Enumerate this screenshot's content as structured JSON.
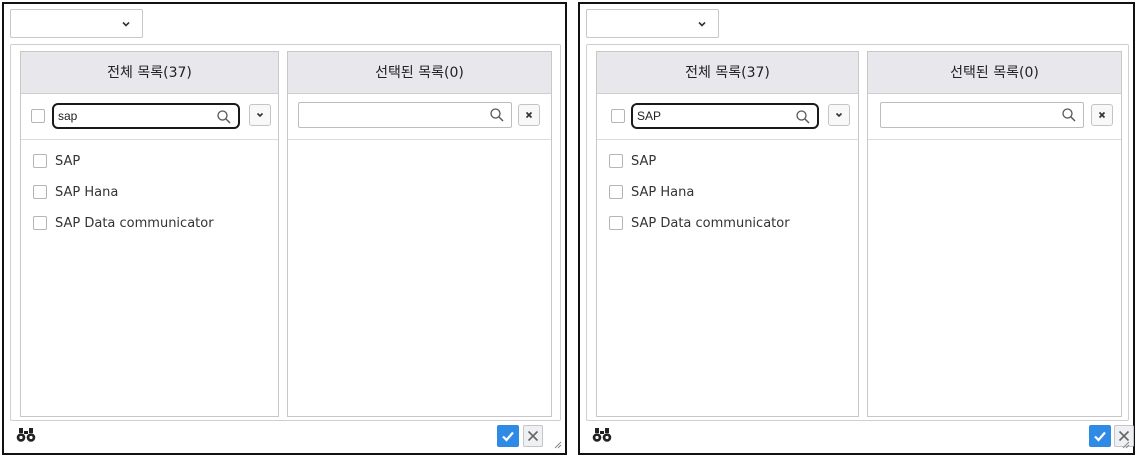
{
  "panels": [
    {
      "top_select": {
        "value": ""
      },
      "all_list": {
        "header": "전체 목록(37)",
        "search_value": "sap",
        "items": [
          {
            "label": "SAP"
          },
          {
            "label": "SAP Hana"
          },
          {
            "label": "SAP Data communicator"
          }
        ]
      },
      "selected_list": {
        "header": "선택된 목록(0)",
        "search_value": ""
      }
    },
    {
      "top_select": {
        "value": ""
      },
      "all_list": {
        "header": "전체 목록(37)",
        "search_value": "SAP",
        "items": [
          {
            "label": "SAP"
          },
          {
            "label": "SAP Hana"
          },
          {
            "label": "SAP Data communicator"
          }
        ]
      },
      "selected_list": {
        "header": "선택된 목록(0)",
        "search_value": ""
      }
    }
  ],
  "colors": {
    "confirm_button": "#2f8ae6",
    "header_bg": "#e8e8ec"
  },
  "icons": [
    "chevron-down-icon",
    "search-icon",
    "close-icon",
    "binoculars-icon",
    "check-icon",
    "x-icon",
    "resize-grip-icon"
  ]
}
